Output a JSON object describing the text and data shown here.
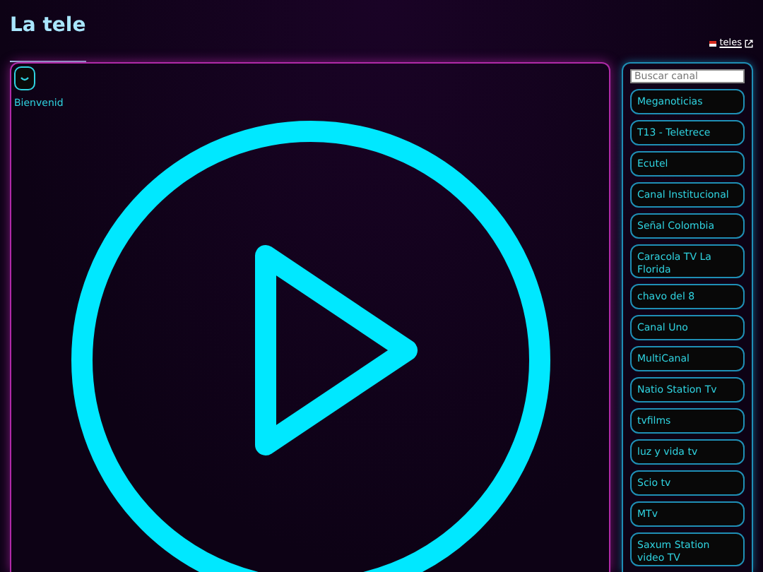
{
  "header": {
    "title": "La tele",
    "link": {
      "label": "teles"
    }
  },
  "player": {
    "welcome": "Bienvenid"
  },
  "sidebar": {
    "search": {
      "placeholder": "Buscar canal"
    },
    "channels": [
      {
        "label": "Meganoticias"
      },
      {
        "label": "T13 - Teletrece"
      },
      {
        "label": "Ecutel"
      },
      {
        "label": "Canal Institucional"
      },
      {
        "label": "Señal Colombia"
      },
      {
        "label": "Caracola TV La Florida"
      },
      {
        "label": "chavo del 8"
      },
      {
        "label": "Canal Uno"
      },
      {
        "label": "MultiCanal"
      },
      {
        "label": "Natio Station Tv"
      },
      {
        "label": "tvfilms"
      },
      {
        "label": "luz y vida tv"
      },
      {
        "label": "Scio tv"
      },
      {
        "label": "MTv"
      },
      {
        "label": "Saxum Station video TV"
      }
    ]
  }
}
